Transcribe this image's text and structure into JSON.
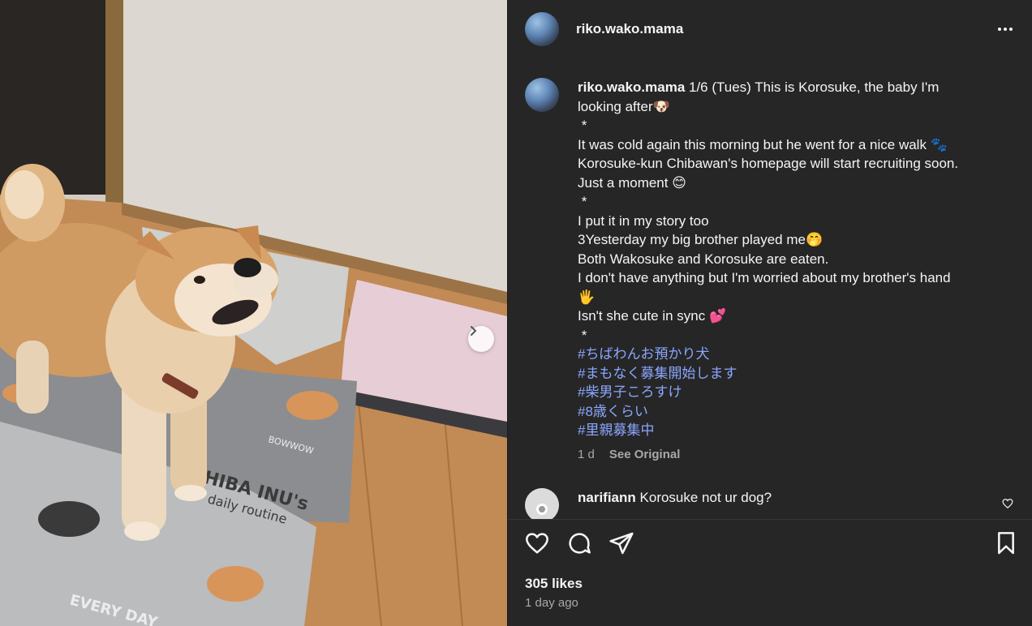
{
  "post": {
    "username": "riko.wako.mama",
    "more_icon": "more-horizontal-icon"
  },
  "caption": {
    "username": "riko.wako.mama",
    "lines": [
      " 1/6 (Tues) This is Korosuke, the baby I'm",
      "looking after🐶",
      " *",
      "It was cold again this morning but he went for a nice walk 🐾",
      "Korosuke-kun Chibawan's homepage will start recruiting soon.",
      "Just a moment 😊",
      " *",
      "I put it in my story too",
      "3Yesterday my big brother played me🤭",
      "Both Wakosuke and Korosuke are eaten.",
      "I don't have anything but I'm worried about my brother's hand",
      "🖐",
      "Isn't she cute in sync 💕",
      " *"
    ],
    "hashtags": [
      "#ちばわんお預かり犬",
      "#まもなく募集開始します",
      "#柴男子ころすけ",
      "#8歳くらい",
      "#里親募集中"
    ],
    "age": "1 d",
    "see_original": "See Original"
  },
  "comment": {
    "username": "narifiann",
    "text": " Korosuke not ur dog?"
  },
  "footer": {
    "likes": "305 likes",
    "time": "1 day ago"
  },
  "colors": {
    "panel_bg": "#262626",
    "hashtag": "#8aa6ff",
    "muted": "#a8a8a8"
  }
}
